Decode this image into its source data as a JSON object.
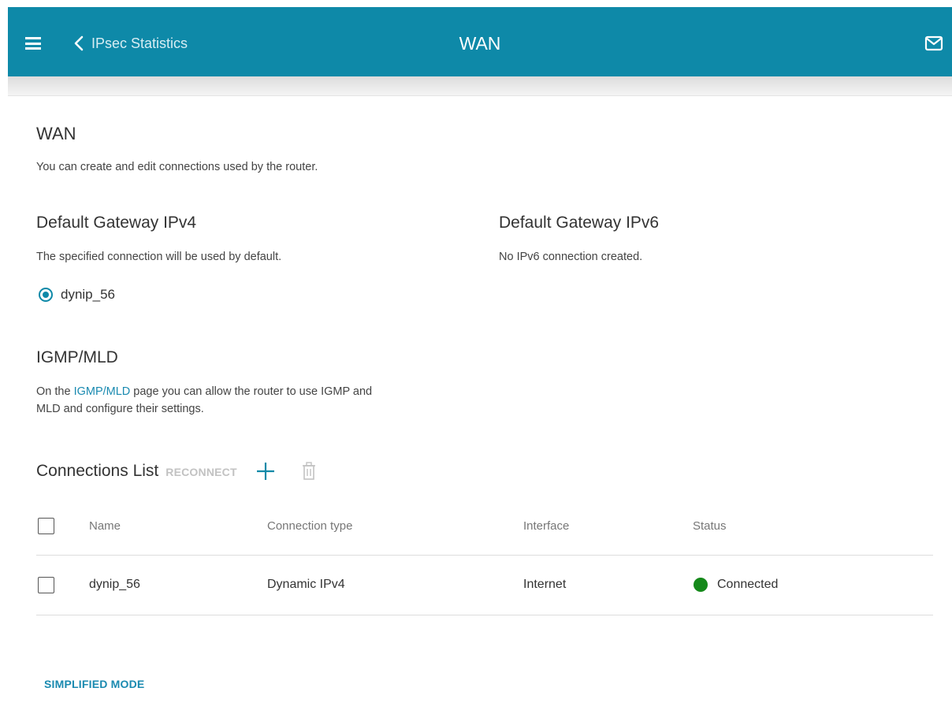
{
  "header": {
    "back_label": "IPsec Statistics",
    "title": "WAN",
    "background_color": "#0e89a8"
  },
  "page": {
    "title": "WAN",
    "description": "You can create and edit connections used by the router."
  },
  "gateway_ipv4": {
    "title": "Default Gateway IPv4",
    "description": "The specified connection will be used by default.",
    "selected_connection": "dynip_56"
  },
  "gateway_ipv6": {
    "title": "Default Gateway IPv6",
    "description": "No IPv6 connection created."
  },
  "igmp": {
    "title": "IGMP/MLD",
    "text_before": "On the ",
    "link": "IGMP/MLD",
    "text_after_line1": " page you can allow the router to use IGMP and",
    "text_line2": "MLD and configure their settings."
  },
  "connections": {
    "title": "Connections List",
    "reconnect_label": "RECONNECT",
    "columns": [
      "Name",
      "Connection type",
      "Interface",
      "Status"
    ],
    "rows": [
      {
        "name": "dynip_56",
        "type": "Dynamic IPv4",
        "interface": "Internet",
        "status": "Connected",
        "status_color": "#15891a"
      }
    ]
  },
  "footer": {
    "simplified_mode_label": "SIMPLIFIED MODE"
  },
  "icons": {
    "menu": "menu-icon",
    "back": "chevron-left-icon",
    "mail": "mail-icon",
    "add": "plus-icon",
    "delete": "trash-icon"
  }
}
